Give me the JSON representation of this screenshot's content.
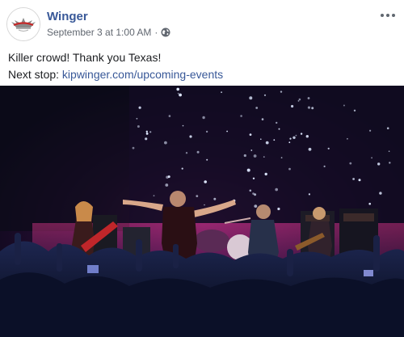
{
  "post": {
    "author": "Winger",
    "timestamp": "September 3 at 1:00 AM",
    "separator": "·",
    "line1": "Killer crowd! Thank you Texas!",
    "line2_prefix": "Next stop: ",
    "link_text": "kipwinger.com/upcoming-events"
  },
  "icons": {
    "privacy": "globe-icon",
    "options": "more-options-icon"
  },
  "colors": {
    "author_link": "#385898",
    "meta_text": "#616770",
    "stage_light": "#c0307a"
  }
}
